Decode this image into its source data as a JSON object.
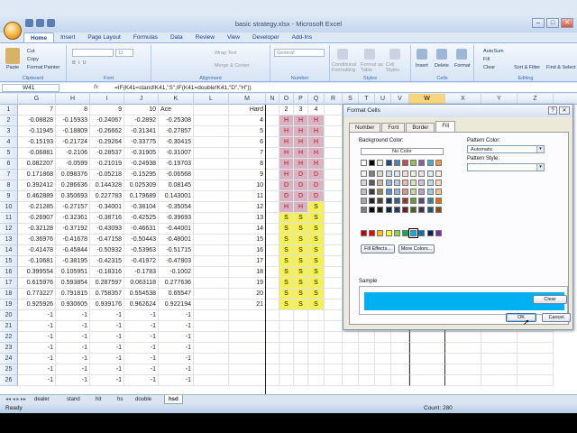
{
  "window": {
    "title": "basic strategy.xlsx - Microsoft Excel",
    "min": "–",
    "max": "□",
    "close": "✕"
  },
  "ribbon_tabs": [
    "Home",
    "Insert",
    "Page Layout",
    "Formulas",
    "Data",
    "Review",
    "View",
    "Developer",
    "Add-Ins"
  ],
  "ribbon": {
    "paste": "Paste",
    "cut": "Cut",
    "copy": "Copy",
    "format_painter": "Format Painter",
    "clipboard": "Clipboard",
    "font": "Font",
    "alignment": "Alignment",
    "number": "Number",
    "styles": "Styles",
    "cells": "Cells",
    "editing": "Editing",
    "font_name": "",
    "font_size": "11",
    "number_format": "General",
    "wrap_text": "Wrap Text",
    "merge_center": "Merge & Center",
    "cond_format": "Conditional Formatting",
    "format_table": "Format as Table",
    "cell_styles": "Cell Styles",
    "insert": "Insert",
    "delete": "Delete",
    "format": "Format",
    "autosum": "AutoSum",
    "fill": "Fill",
    "clear": "Clear",
    "sort_filter": "Sort & Filter",
    "find_select": "Find & Select"
  },
  "formula_bar": {
    "cell_ref": "W41",
    "fx": "fx",
    "formula": "=IF(K41=stand!K41,\"S\",IF(K41=double!K41,\"D\",\"H\"))"
  },
  "columns": [
    "G",
    "H",
    "I",
    "J",
    "K",
    "L",
    "M",
    "N",
    "O",
    "P",
    "Q",
    "R",
    "S",
    "T",
    "U",
    "V",
    "W",
    "X",
    "Y",
    "Z"
  ],
  "row_numbers": [
    "1",
    "2",
    "3",
    "4",
    "5",
    "6",
    "7",
    "8",
    "9",
    "10",
    "11",
    "12",
    "13",
    "14",
    "15",
    "16",
    "17",
    "18",
    "19",
    "20",
    "21",
    "22",
    "23",
    "24",
    "25",
    "26"
  ],
  "rows": [
    [
      "7",
      "8",
      "9",
      "10",
      "Ace",
      "",
      "Hard",
      "",
      "2",
      "3",
      "4"
    ],
    [
      "-0.08828",
      "-0.15933",
      "-0.24067",
      "-0.2892",
      "-0.25308",
      "",
      "4",
      "",
      "H",
      "H",
      "H"
    ],
    [
      "-0.11945",
      "-0.18809",
      "-0.26662",
      "-0.31341",
      "-0.27857",
      "",
      "5",
      "",
      "H",
      "H",
      "H"
    ],
    [
      "-0.15193",
      "-0.21724",
      "-0.29264",
      "-0.33775",
      "-0.30415",
      "",
      "6",
      "",
      "H",
      "H",
      "H"
    ],
    [
      "-0.06881",
      "-0.2106",
      "-0.28537",
      "-0.31905",
      "-0.31007",
      "",
      "7",
      "",
      "H",
      "H",
      "H"
    ],
    [
      "0.082207",
      "-0.0599",
      "-0.21019",
      "-0.24938",
      "-0.19703",
      "",
      "8",
      "",
      "H",
      "H",
      "H"
    ],
    [
      "0.171868",
      "0.098376",
      "-0.05218",
      "-0.15295",
      "-0.06568",
      "",
      "9",
      "",
      "H",
      "D",
      "D"
    ],
    [
      "0.392412",
      "0.286636",
      "0.144328",
      "0.025309",
      "0.08145",
      "",
      "10",
      "",
      "D",
      "D",
      "D"
    ],
    [
      "0.462889",
      "0.350693",
      "0.227783",
      "0.179689",
      "0.143001",
      "",
      "11",
      "",
      "D",
      "D",
      "D"
    ],
    [
      "-0.21285",
      "-0.27157",
      "-0.34001",
      "-0.38104",
      "-0.35054",
      "",
      "12",
      "",
      "H",
      "H",
      "S"
    ],
    [
      "-0.26907",
      "-0.32361",
      "-0.38716",
      "-0.42525",
      "-0.39693",
      "",
      "13",
      "",
      "S",
      "S",
      "S"
    ],
    [
      "-0.32128",
      "-0.37192",
      "-0.43093",
      "-0.46631",
      "-0.44001",
      "",
      "14",
      "",
      "S",
      "S",
      "S"
    ],
    [
      "-0.36976",
      "-0.41678",
      "-0.47158",
      "-0.50443",
      "-0.48001",
      "",
      "15",
      "",
      "S",
      "S",
      "S"
    ],
    [
      "-0.41478",
      "-0.45844",
      "-0.50932",
      "-0.53963",
      "-0.51715",
      "",
      "16",
      "",
      "S",
      "S",
      "S"
    ],
    [
      "-0.10681",
      "-0.38195",
      "-0.42315",
      "-0.41972",
      "-0.47803",
      "",
      "17",
      "",
      "S",
      "S",
      "S"
    ],
    [
      "0.399554",
      "0.105951",
      "-0.18316",
      "-0.1783",
      "-0.1002",
      "",
      "18",
      "",
      "S",
      "S",
      "S"
    ],
    [
      "0.615976",
      "0.593854",
      "0.287597",
      "0.063118",
      "0.277636",
      "",
      "19",
      "",
      "S",
      "S",
      "S"
    ],
    [
      "0.773227",
      "0.791815",
      "0.758357",
      "0.554538",
      "0.65547",
      "",
      "20",
      "",
      "S",
      "S",
      "S"
    ],
    [
      "0.925926",
      "0.930605",
      "0.939176",
      "0.962624",
      "0.922194",
      "",
      "21",
      "",
      "S",
      "S",
      "S"
    ],
    [
      "-1",
      "-1",
      "-1",
      "-1",
      "-1",
      "",
      "",
      "",
      "",
      "",
      ""
    ],
    [
      "-1",
      "-1",
      "-1",
      "-1",
      "-1",
      "",
      "",
      "",
      "",
      "",
      ""
    ],
    [
      "-1",
      "-1",
      "-1",
      "-1",
      "-1",
      "",
      "",
      "",
      "",
      "",
      ""
    ],
    [
      "-1",
      "-1",
      "-1",
      "-1",
      "-1",
      "",
      "",
      "",
      "",
      "",
      ""
    ],
    [
      "-1",
      "-1",
      "-1",
      "-1",
      "-1",
      "",
      "",
      "",
      "",
      "",
      ""
    ],
    [
      "-1",
      "-1",
      "-1",
      "-1",
      "-1",
      "",
      "",
      "",
      "",
      "",
      ""
    ],
    [
      "-1",
      "-1",
      "-1",
      "-1",
      "-1",
      "",
      "",
      "",
      "",
      "",
      ""
    ]
  ],
  "sheet_tabs": [
    "dealer",
    "stand",
    "hit",
    "hs",
    "double",
    "hsd"
  ],
  "active_sheet": "hsd",
  "status": {
    "ready": "Ready",
    "count": "Count: 280"
  },
  "dialog": {
    "title": "Format Cells",
    "help": "?",
    "close": "✕",
    "tabs": [
      "Number",
      "Font",
      "Border",
      "Fill"
    ],
    "active_tab": "Fill",
    "background_color_label": "Background Color:",
    "no_color": "No Color",
    "fill_effects": "Fill Effects...",
    "more_colors": "More Colors...",
    "pattern_color_label": "Pattern Color:",
    "pattern_color_value": "Automatic",
    "pattern_style_label": "Pattern Style:",
    "pattern_style_value": "",
    "sample_label": "Sample",
    "clear": "Clear",
    "ok": "OK",
    "cancel": "Cancel",
    "sample_color": "#00b0f0",
    "palette": [
      [
        "#ffffff",
        "#000000",
        "#eeece1",
        "#1f497d",
        "#4f81bd",
        "#c0504d",
        "#9bbb59",
        "#8064a2",
        "#4bacc6",
        "#f79646"
      ],
      [
        "#f2f2f2",
        "#7f7f7f",
        "#ddd9c3",
        "#c6d9f0",
        "#dbe5f1",
        "#f2dcdb",
        "#ebf1dd",
        "#e5e0ec",
        "#dbeef3",
        "#fdeada"
      ],
      [
        "#d8d8d8",
        "#595959",
        "#c4bd97",
        "#8db3e2",
        "#b8cce4",
        "#e5b9b7",
        "#d7e3bc",
        "#ccc1d9",
        "#b7dde8",
        "#fbd5b5"
      ],
      [
        "#bfbfbf",
        "#3f3f3f",
        "#938953",
        "#548dd4",
        "#95b3d7",
        "#d99694",
        "#c3d69b",
        "#b2a2c7",
        "#92cddc",
        "#fac08f"
      ],
      [
        "#a5a5a5",
        "#262626",
        "#494429",
        "#17365d",
        "#366092",
        "#953734",
        "#76923c",
        "#5f497a",
        "#31859b",
        "#e36c09"
      ],
      [
        "#7f7f7f",
        "#0c0c0c",
        "#1d1b10",
        "#0f243e",
        "#244061",
        "#632423",
        "#4f6128",
        "#3f3151",
        "#205867",
        "#974806"
      ],
      [
        "#c00000",
        "#ff0000",
        "#ffc000",
        "#ffff00",
        "#92d050",
        "#00b050",
        "#00b0f0",
        "#0070c0",
        "#002060",
        "#7030a0"
      ]
    ]
  }
}
